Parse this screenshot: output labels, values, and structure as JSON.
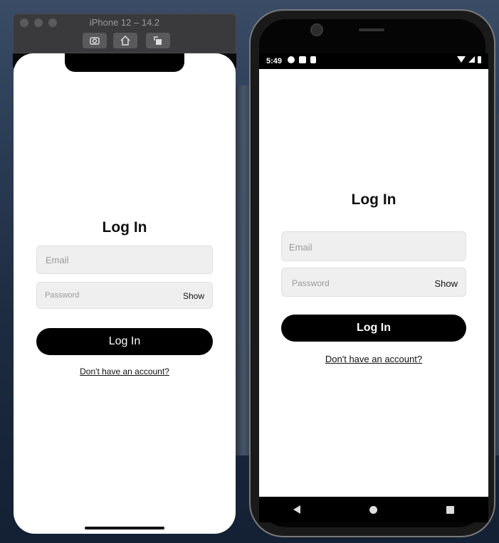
{
  "simulator": {
    "window_title": "iPhone 12 – 14.2",
    "toolbar": {
      "screenshot_icon": "camera-icon",
      "home_icon": "home-icon",
      "rotate_icon": "rotate-icon"
    }
  },
  "ios_app": {
    "title": "Log In",
    "email_placeholder": "Email",
    "password_placeholder": "Password",
    "show_label": "Show",
    "login_button": "Log In",
    "signup_link": "Don't have an account?"
  },
  "android": {
    "status": {
      "time": "5:49",
      "left_icons": [
        "gear-icon",
        "mail-icon",
        "sd-card-icon"
      ],
      "right_icons": [
        "wifi-icon",
        "signal-icon",
        "battery-icon"
      ]
    },
    "app": {
      "title": "Log In",
      "email_placeholder": "Email",
      "password_placeholder": "Password",
      "show_label": "Show",
      "login_button": "Log In",
      "signup_link": "Don't have an account?"
    },
    "nav": [
      "back-icon",
      "home-icon",
      "recents-icon"
    ]
  },
  "colors": {
    "button_bg": "#000000",
    "field_bg": "#efefef",
    "placeholder": "#9a9a9a"
  }
}
